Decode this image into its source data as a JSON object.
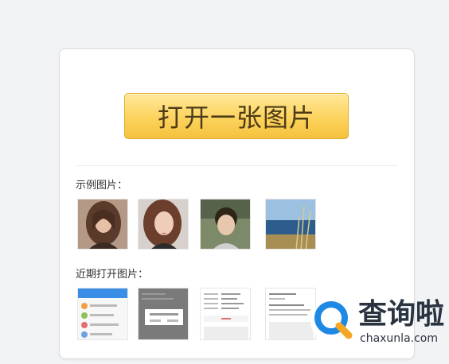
{
  "open_button": {
    "label": "打开一张图片"
  },
  "sample_section": {
    "label": "示例图片："
  },
  "recent_section": {
    "label": "近期打开图片："
  },
  "watermark": {
    "name": "查询啦",
    "domain": "chaxunla.com"
  },
  "colors": {
    "button_top": "#ffe89a",
    "button_bottom": "#f6c13d",
    "button_text": "#4d3b18",
    "watermark_blue": "#1e88e5",
    "watermark_orange": "#f5a623"
  }
}
